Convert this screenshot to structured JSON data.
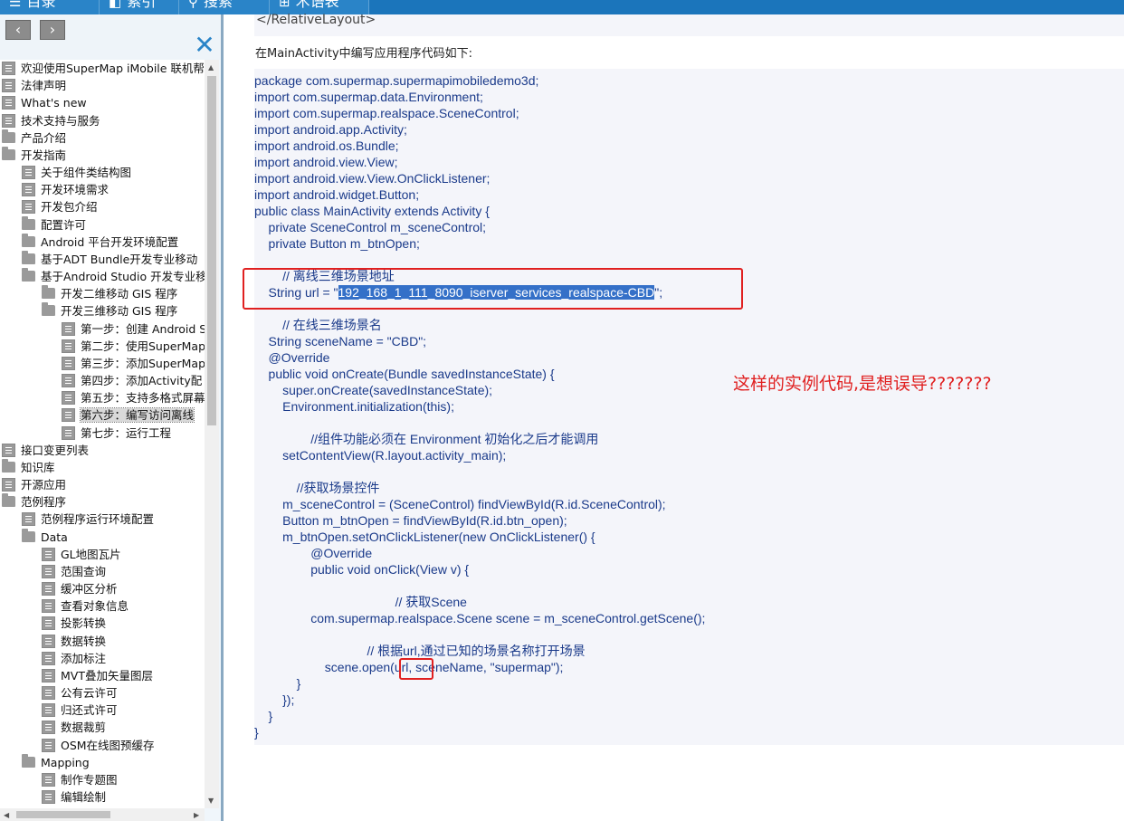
{
  "toolbar": {
    "buttons": [
      {
        "label": "目录",
        "icon": "list-icon"
      },
      {
        "label": "索引",
        "icon": "book-icon"
      },
      {
        "label": "搜索",
        "icon": "search-icon"
      },
      {
        "label": "术语表",
        "icon": "glossary-icon"
      }
    ]
  },
  "nav": {
    "back": "‹",
    "forward": "›",
    "close": "✕"
  },
  "tree": {
    "items": [
      {
        "label": "欢迎使用SuperMap iMobile 联机帮助",
        "icon": "page"
      },
      {
        "label": "法律声明",
        "icon": "page"
      },
      {
        "label": "What's new",
        "icon": "page"
      },
      {
        "label": "技术支持与服务",
        "icon": "page"
      },
      {
        "label": "产品介绍",
        "icon": "folder"
      },
      {
        "label": "开发指南",
        "icon": "folder"
      },
      {
        "label": "关于组件类结构图",
        "icon": "page"
      },
      {
        "label": "开发环境需求",
        "icon": "page"
      },
      {
        "label": "开发包介绍",
        "icon": "page"
      },
      {
        "label": "配置许可",
        "icon": "folder"
      },
      {
        "label": "Android 平台开发环境配置",
        "icon": "folder"
      },
      {
        "label": "基于ADT Bundle开发专业移动",
        "icon": "folder"
      },
      {
        "label": "基于Android Studio 开发专业移",
        "icon": "folder"
      },
      {
        "label": "开发二维移动 GIS 程序",
        "icon": "folder"
      },
      {
        "label": "开发三维移动 GIS 程序",
        "icon": "folder"
      },
      {
        "label": "第一步：创建 Android S",
        "icon": "page"
      },
      {
        "label": "第二步：使用SuperMap",
        "icon": "page"
      },
      {
        "label": "第三步：添加SuperMap",
        "icon": "page"
      },
      {
        "label": "第四步：添加Activity配",
        "icon": "page"
      },
      {
        "label": "第五步：支持多格式屏幕",
        "icon": "page"
      },
      {
        "label": "第六步：编写访问离线",
        "icon": "page",
        "selected": true
      },
      {
        "label": "第七步：运行工程",
        "icon": "page"
      },
      {
        "label": "接口变更列表",
        "icon": "page"
      },
      {
        "label": "知识库",
        "icon": "folder"
      },
      {
        "label": "开源应用",
        "icon": "page"
      },
      {
        "label": "范例程序",
        "icon": "folder"
      },
      {
        "label": "范例程序运行环境配置",
        "icon": "page"
      },
      {
        "label": "Data",
        "icon": "folder"
      },
      {
        "label": "GL地图瓦片",
        "icon": "page"
      },
      {
        "label": "范围查询",
        "icon": "page"
      },
      {
        "label": "缓冲区分析",
        "icon": "page"
      },
      {
        "label": "查看对象信息",
        "icon": "page"
      },
      {
        "label": "投影转换",
        "icon": "page"
      },
      {
        "label": "数据转换",
        "icon": "page"
      },
      {
        "label": "添加标注",
        "icon": "page"
      },
      {
        "label": "MVT叠加矢量图层",
        "icon": "page"
      },
      {
        "label": "公有云许可",
        "icon": "page"
      },
      {
        "label": "归还式许可",
        "icon": "page"
      },
      {
        "label": "数据裁剪",
        "icon": "page"
      },
      {
        "label": "OSM在线图预缓存",
        "icon": "page"
      },
      {
        "label": "Mapping",
        "icon": "folder"
      },
      {
        "label": "制作专题图",
        "icon": "page"
      },
      {
        "label": "编辑绘制",
        "icon": "page"
      }
    ]
  },
  "content": {
    "prev_line": "</RelativeLayout>",
    "intro": "在MainActivity中编写应用程序代码如下:",
    "code_lines": [
      "package com.supermap.supermapimobiledemo3d;",
      "import com.supermap.data.Environment;",
      "import com.supermap.realspace.SceneControl;",
      "import android.app.Activity;",
      "import android.os.Bundle;",
      "import android.view.View;",
      "import android.view.View.OnClickListener;",
      "import android.widget.Button;",
      "public class MainActivity extends Activity {",
      "    private SceneControl m_sceneControl;",
      "    private Button m_btnOpen;",
      "",
      "        // 离线三维场景地址",
      "    String url = \"",
      "",
      "        // 在线三维场景名",
      "    String sceneName = \"CBD\";",
      "    @Override",
      "    public void onCreate(Bundle savedInstanceState) {",
      "        super.onCreate(savedInstanceState);",
      "        Environment.initialization(this);",
      "",
      "                //组件功能必须在 Environment 初始化之后才能调用",
      "        setContentView(R.layout.activity_main);",
      "",
      "            //获取场景控件",
      "        m_sceneControl = (SceneControl) findViewById(R.id.SceneControl);",
      "        Button m_btnOpen = findViewById(R.id.btn_open);",
      "        m_btnOpen.setOnClickListener(new OnClickListener() {",
      "                @Override",
      "                public void onClick(View v) {",
      "",
      "                                        // 获取Scene",
      "                com.supermap.realspace.Scene scene = m_sceneControl.getScene();",
      "",
      "                                // 根据url,通过已知的场景名称打开场景",
      "                    scene.open(url, sceneName, \"supermap\");",
      "            }",
      "        });",
      "    }",
      "}"
    ],
    "url_value": "192_168_1_111_8090_iserver_services_realspace-CBD",
    "url_suffix": "\";"
  },
  "annotation": {
    "text": "这样的实例代码,是想误导???????",
    "color": "#e02020"
  }
}
